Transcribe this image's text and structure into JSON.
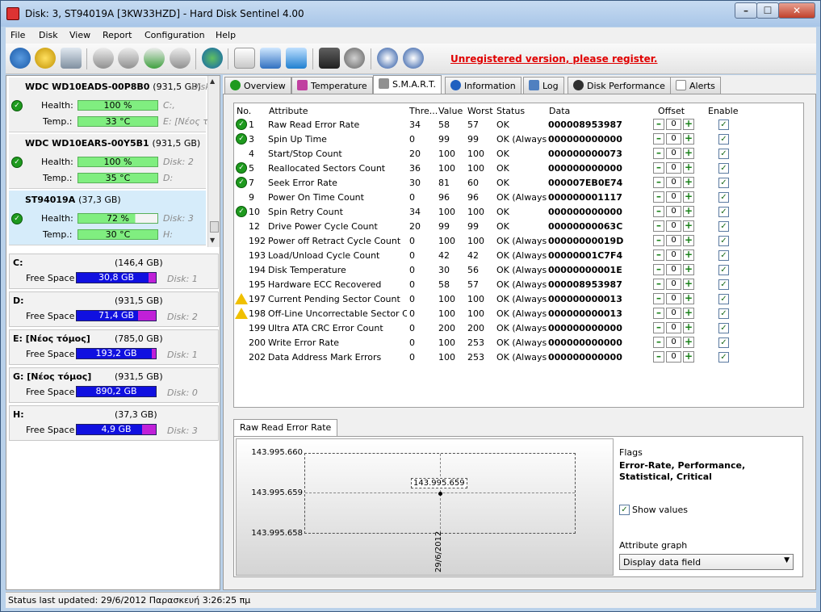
{
  "window": {
    "title": "Disk: 3, ST94019A [3KW33HZD]  -  Hard Disk Sentinel 4.00"
  },
  "menu": [
    "File",
    "Disk",
    "View",
    "Report",
    "Configuration",
    "Help"
  ],
  "toolbar": {
    "unregistered": "Unregistered version, please register."
  },
  "disks": [
    {
      "name": "WDC WD10EADS-00P8B0",
      "size": "(931,5 GB)",
      "disk_label": "Disk",
      "health": "100 %",
      "health_pct": 100,
      "temp": "33 °C",
      "vol1": "C:,",
      "vol2": "E: [Νέος τό"
    },
    {
      "name": "WDC WD10EARS-00Y5B1",
      "size": "(931,5 GB)",
      "disk_label": "Disk: 2",
      "health": "100 %",
      "health_pct": 100,
      "temp": "35 °C",
      "vol1": "D:",
      "vol2": ""
    },
    {
      "name": "ST94019A",
      "size": "(37,3 GB)",
      "disk_label": "Disk: 3",
      "health": "72 %",
      "health_pct": 72,
      "temp": "30 °C",
      "vol1": "H:",
      "vol2": ""
    }
  ],
  "labels": {
    "health": "Health:",
    "temp": "Temp.:",
    "free_space": "Free Space"
  },
  "volumes": [
    {
      "name": "C:",
      "size": "(146,4 GB)",
      "free": "30,8 GB",
      "free_pct": 21,
      "disk": "Disk: 1"
    },
    {
      "name": "D:",
      "size": "(931,5 GB)",
      "free": "71,4 GB",
      "free_pct": 8,
      "disk": "Disk: 2"
    },
    {
      "name": "E: [Νέος τόμος]",
      "size": "(785,0 GB)",
      "free": "193,2 GB",
      "free_pct": 25,
      "disk": "Disk: 1"
    },
    {
      "name": "G: [Νέος τόμος]",
      "size": "(931,5 GB)",
      "free": "890,2 GB",
      "free_pct": 96,
      "disk": "Disk: 0"
    },
    {
      "name": "H:",
      "size": "(37,3 GB)",
      "free": "4,9 GB",
      "free_pct": 13,
      "disk": "Disk: 3"
    }
  ],
  "tabs": [
    "Overview",
    "Temperature",
    "S.M.A.R.T.",
    "Information",
    "Log",
    "Disk Performance",
    "Alerts"
  ],
  "smart_headers": {
    "no": "No.",
    "attribute": "Attribute",
    "thresh": "Thre...",
    "value": "Value",
    "worst": "Worst",
    "status": "Status",
    "data": "Data",
    "offset": "Offset",
    "enable": "Enable"
  },
  "smart_rows": [
    {
      "icon": "ok",
      "no": "1",
      "attr": "Raw Read Error Rate",
      "thr": "34",
      "val": "58",
      "worst": "57",
      "status": "OK",
      "data": "000008953987"
    },
    {
      "icon": "ok",
      "no": "3",
      "attr": "Spin Up Time",
      "thr": "0",
      "val": "99",
      "worst": "99",
      "status": "OK (Always...",
      "data": "000000000000"
    },
    {
      "icon": "",
      "no": "4",
      "attr": "Start/Stop Count",
      "thr": "20",
      "val": "100",
      "worst": "100",
      "status": "OK",
      "data": "000000000073"
    },
    {
      "icon": "ok",
      "no": "5",
      "attr": "Reallocated Sectors Count",
      "thr": "36",
      "val": "100",
      "worst": "100",
      "status": "OK",
      "data": "000000000000"
    },
    {
      "icon": "ok",
      "no": "7",
      "attr": "Seek Error Rate",
      "thr": "30",
      "val": "81",
      "worst": "60",
      "status": "OK",
      "data": "000007EB0E74"
    },
    {
      "icon": "",
      "no": "9",
      "attr": "Power On Time Count",
      "thr": "0",
      "val": "96",
      "worst": "96",
      "status": "OK (Always...",
      "data": "000000001117"
    },
    {
      "icon": "ok",
      "no": "10",
      "attr": "Spin Retry Count",
      "thr": "34",
      "val": "100",
      "worst": "100",
      "status": "OK",
      "data": "000000000000"
    },
    {
      "icon": "",
      "no": "12",
      "attr": "Drive Power Cycle Count",
      "thr": "20",
      "val": "99",
      "worst": "99",
      "status": "OK",
      "data": "00000000063C"
    },
    {
      "icon": "",
      "no": "192",
      "attr": "Power off Retract Cycle Count",
      "thr": "0",
      "val": "100",
      "worst": "100",
      "status": "OK (Always...",
      "data": "00000000019D"
    },
    {
      "icon": "",
      "no": "193",
      "attr": "Load/Unload Cycle Count",
      "thr": "0",
      "val": "42",
      "worst": "42",
      "status": "OK (Always...",
      "data": "00000001C7F4"
    },
    {
      "icon": "",
      "no": "194",
      "attr": "Disk Temperature",
      "thr": "0",
      "val": "30",
      "worst": "56",
      "status": "OK (Always...",
      "data": "00000000001E"
    },
    {
      "icon": "",
      "no": "195",
      "attr": "Hardware ECC Recovered",
      "thr": "0",
      "val": "58",
      "worst": "57",
      "status": "OK (Always...",
      "data": "000008953987"
    },
    {
      "icon": "warn",
      "no": "197",
      "attr": "Current Pending Sector Count",
      "thr": "0",
      "val": "100",
      "worst": "100",
      "status": "OK (Always...",
      "data": "000000000013"
    },
    {
      "icon": "warn",
      "no": "198",
      "attr": "Off-Line Uncorrectable Sector C...",
      "thr": "0",
      "val": "100",
      "worst": "100",
      "status": "OK (Always...",
      "data": "000000000013"
    },
    {
      "icon": "",
      "no": "199",
      "attr": "Ultra ATA CRC Error Count",
      "thr": "0",
      "val": "200",
      "worst": "200",
      "status": "OK (Always...",
      "data": "000000000000"
    },
    {
      "icon": "",
      "no": "200",
      "attr": "Write Error Rate",
      "thr": "0",
      "val": "100",
      "worst": "253",
      "status": "OK (Always...",
      "data": "000000000000"
    },
    {
      "icon": "",
      "no": "202",
      "attr": "Data Address Mark Errors",
      "thr": "0",
      "val": "100",
      "worst": "253",
      "status": "OK (Always...",
      "data": "000000000000"
    }
  ],
  "offset_value": "0",
  "graph": {
    "tab": "Raw Read Error Rate",
    "flags_label": "Flags",
    "flags_value": "Error-Rate, Performance, Statistical, Critical",
    "show_values": "Show values",
    "attr_graph_label": "Attribute graph",
    "attr_graph_value": "Display data field"
  },
  "chart_data": {
    "type": "scatter",
    "x": [
      "29/6/2012"
    ],
    "y": [
      143995659
    ],
    "point_label": "143.995.659",
    "yticks": [
      "143.995.660",
      "143.995.659",
      "143.995.658"
    ],
    "ylim": [
      143995658,
      143995660
    ],
    "grid": true
  },
  "status": "Status last updated: 29/6/2012 Παρασκευή 3:26:25 πμ"
}
